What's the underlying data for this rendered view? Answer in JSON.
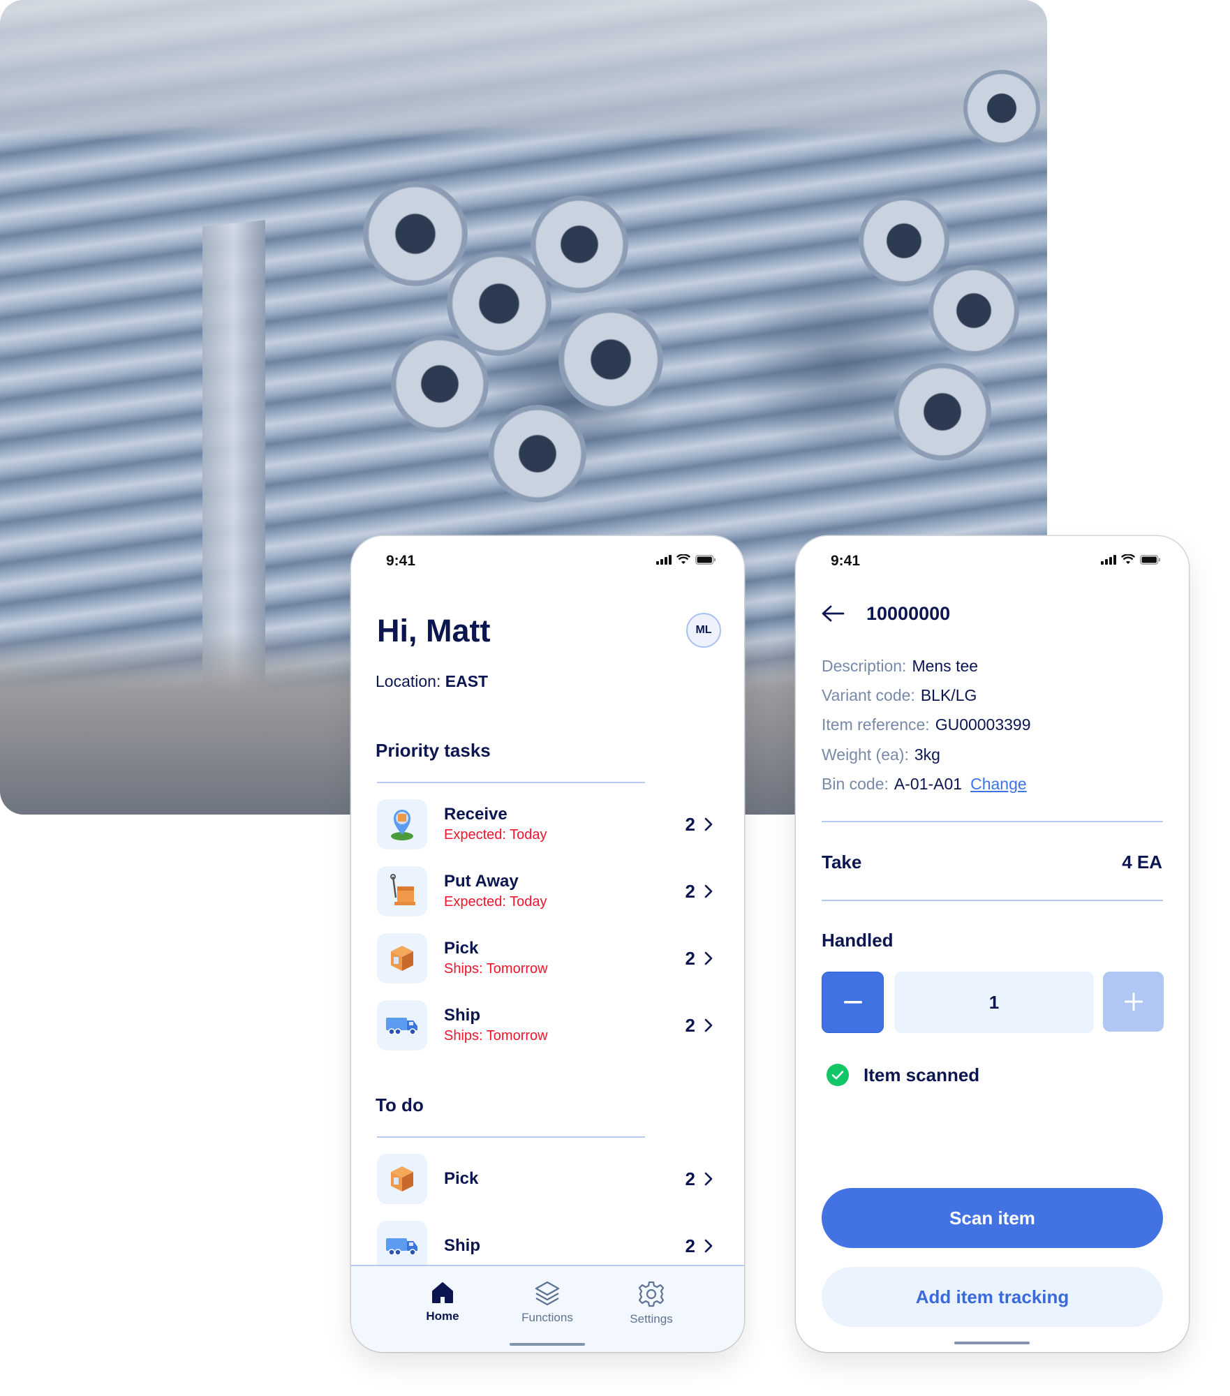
{
  "status_bar": {
    "time": "9:41"
  },
  "home_screen": {
    "greeting": "Hi, Matt",
    "avatar_initials": "ML",
    "location_label": "Location:",
    "location_value": "EAST",
    "priority_title": "Priority tasks",
    "priority_tasks": [
      {
        "title": "Receive",
        "subtitle": "Expected: Today",
        "count": "2",
        "icon": "receive-location-icon"
      },
      {
        "title": "Put Away",
        "subtitle": "Expected: Today",
        "count": "2",
        "icon": "pallet-jack-icon"
      },
      {
        "title": "Pick",
        "subtitle": "Ships: Tomorrow",
        "count": "2",
        "icon": "box-icon"
      },
      {
        "title": "Ship",
        "subtitle": "Ships: Tomorrow",
        "count": "2",
        "icon": "truck-icon"
      }
    ],
    "todo_title": "To do",
    "todo_tasks": [
      {
        "title": "Pick",
        "count": "2",
        "icon": "box-icon"
      },
      {
        "title": "Ship",
        "count": "2",
        "icon": "truck-icon"
      }
    ],
    "nav": [
      {
        "label": "Home",
        "icon": "home-icon",
        "active": true
      },
      {
        "label": "Functions",
        "icon": "layers-icon",
        "active": false
      },
      {
        "label": "Settings",
        "icon": "gear-icon",
        "active": false
      }
    ]
  },
  "item_screen": {
    "title": "10000000",
    "details": [
      {
        "label": "Description:",
        "value": "Mens tee"
      },
      {
        "label": "Variant code:",
        "value": "BLK/LG"
      },
      {
        "label": "Item reference:",
        "value": "GU00003399"
      },
      {
        "label": "Weight (ea):",
        "value": "3kg"
      },
      {
        "label": "Bin code:",
        "value": "A-01-A01",
        "link": "Change"
      }
    ],
    "take_label": "Take",
    "take_value": "4 EA",
    "handled_label": "Handled",
    "handled_quantity": "1",
    "scanned_status": "Item scanned",
    "primary_button": "Scan item",
    "secondary_button": "Add item tracking"
  },
  "colors": {
    "primary": "#4373e2",
    "navy_text": "#0b1550",
    "alert_red": "#f0142d",
    "success_green": "#12c566",
    "light_fill": "#ebf3fe"
  }
}
